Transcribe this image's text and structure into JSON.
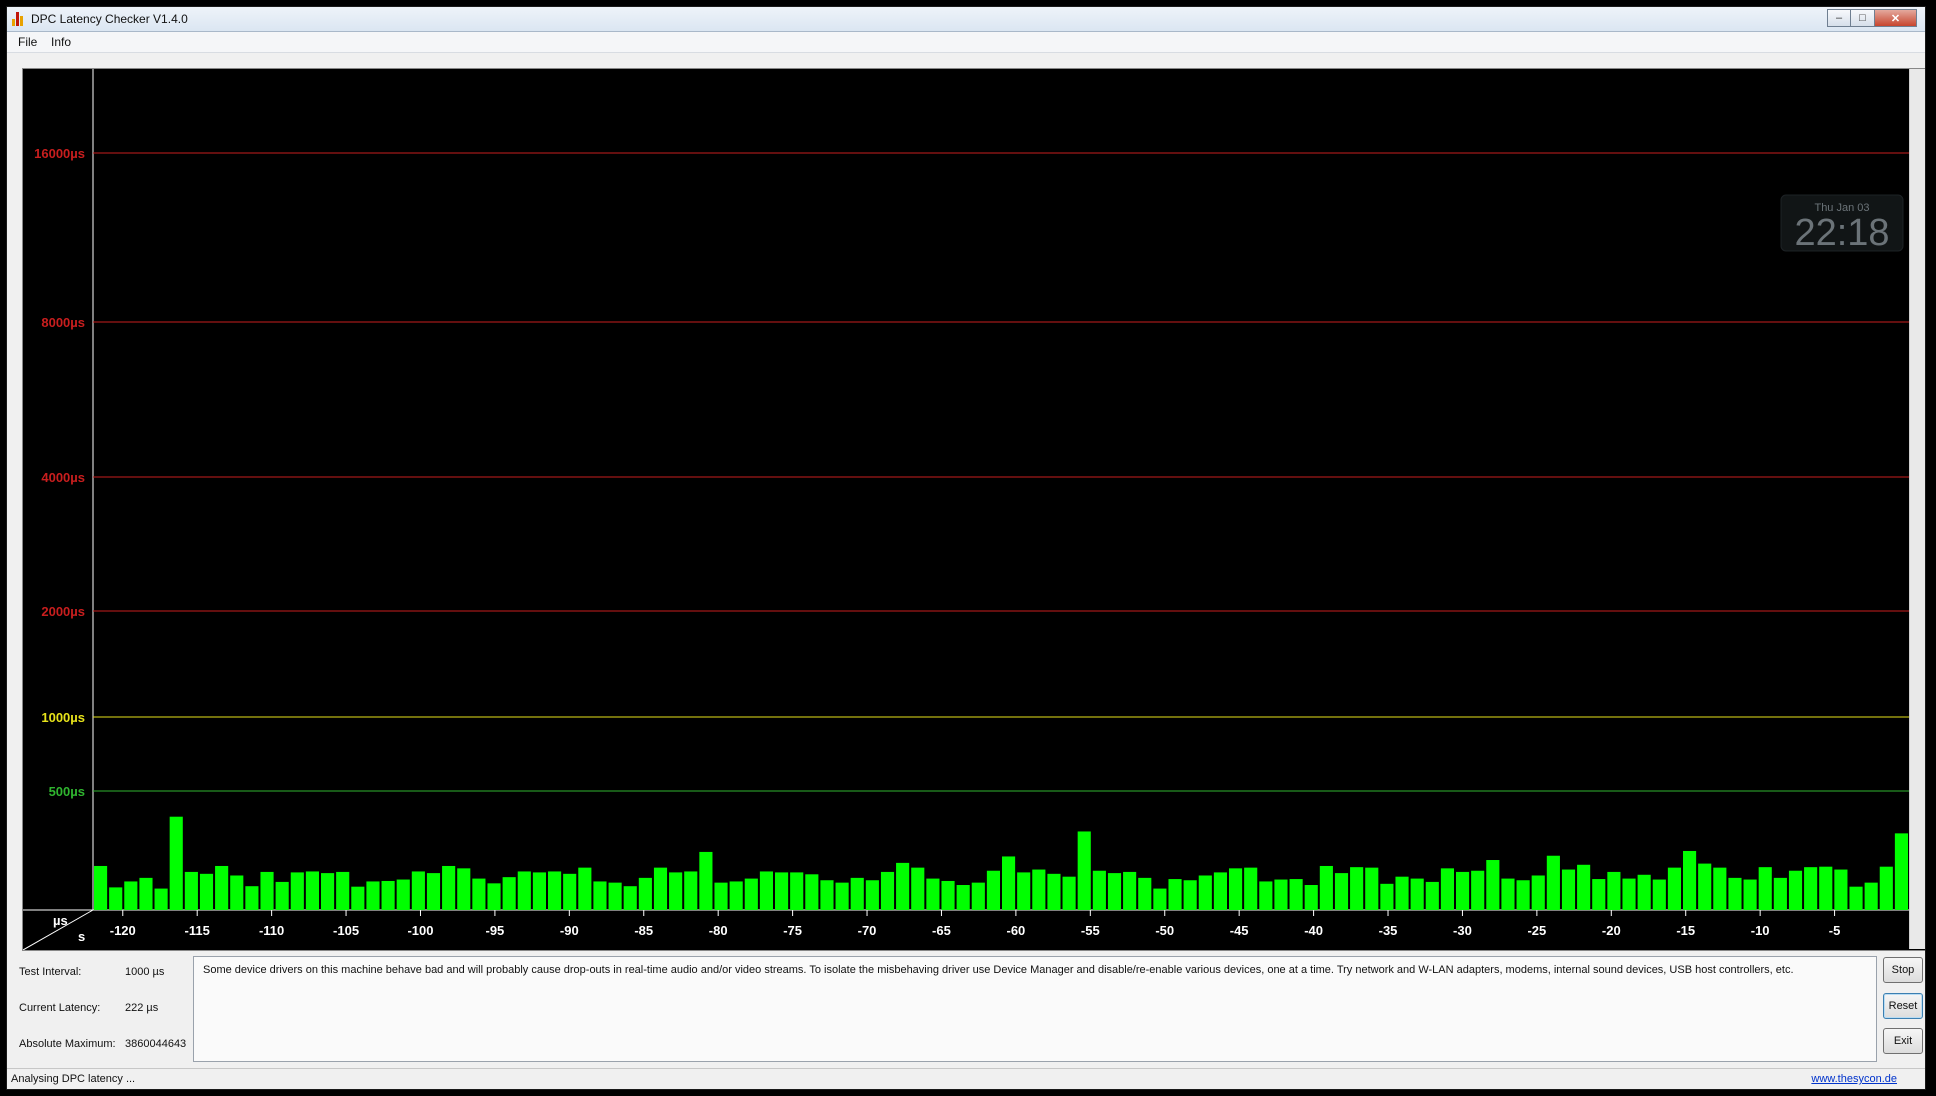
{
  "window": {
    "title": "DPC Latency Checker V1.4.0",
    "controls": {
      "minimize": "–",
      "maximize": "□",
      "close": "✕"
    }
  },
  "menu": {
    "items": [
      "File",
      "Info"
    ]
  },
  "overlay_clock": {
    "date": "Thu Jan 03",
    "time": "22:18"
  },
  "chart_data": {
    "type": "bar",
    "y_unit_label": "µs",
    "x_unit_label": "s",
    "y_levels": [
      {
        "label": "16000µs",
        "value": 16000,
        "color": "#c81e1e"
      },
      {
        "label": "8000µs",
        "value": 8000,
        "color": "#c81e1e"
      },
      {
        "label": "4000µs",
        "value": 4000,
        "color": "#c81e1e"
      },
      {
        "label": "2000µs",
        "value": 2000,
        "color": "#c81e1e"
      },
      {
        "label": "1000µs",
        "value": 1000,
        "color": "#e6e21a"
      },
      {
        "label": "500µs",
        "value": 500,
        "color": "#2fb42f"
      }
    ],
    "x_ticks": [
      "-120",
      "-115",
      "-110",
      "-105",
      "-100",
      "-95",
      "-90",
      "-85",
      "-80",
      "-75",
      "-70",
      "-65",
      "-60",
      "-55",
      "-50",
      "-45",
      "-40",
      "-35",
      "-30",
      "-25",
      "-20",
      "-15",
      "-10",
      "-5"
    ],
    "x_range": [
      -122,
      0
    ],
    "bar_color": "#00ff00",
    "values": [
      185,
      95,
      120,
      135,
      90,
      392,
      160,
      152,
      185,
      145,
      100,
      160,
      118,
      158,
      162,
      155,
      160,
      98,
      120,
      122,
      128,
      162,
      155,
      185,
      175,
      132,
      112,
      138,
      162,
      158,
      162,
      152,
      178,
      120,
      115,
      100,
      135,
      178,
      158,
      162,
      244,
      115,
      120,
      132,
      162,
      158,
      158,
      150,
      125,
      115,
      135,
      125,
      160,
      198,
      178,
      132,
      122,
      105,
      115,
      165,
      225,
      158,
      170,
      152,
      140,
      330,
      165,
      155,
      160,
      135,
      90,
      130,
      125,
      145,
      158,
      175,
      178,
      120,
      128,
      130,
      105,
      185,
      155,
      180,
      178,
      110,
      140,
      132,
      118,
      175,
      160,
      165,
      210,
      132,
      125,
      145,
      228,
      170,
      190,
      130,
      160,
      132,
      148,
      128,
      178,
      248,
      195,
      178,
      135,
      128,
      180,
      135,
      165,
      180,
      182,
      170,
      98,
      115,
      182,
      322
    ]
  },
  "info": {
    "test_interval": {
      "label": "Test Interval:",
      "value": "1000 µs"
    },
    "current_latency": {
      "label": "Current Latency:",
      "value": "222 µs"
    },
    "absolute_maximum": {
      "label": "Absolute Maximum:",
      "value": "3860044643"
    }
  },
  "message": "Some device drivers on this machine behave bad and will probably cause drop-outs in real-time audio and/or video streams. To isolate the misbehaving driver use Device Manager and disable/re-enable various devices, one at a time. Try network and W-LAN adapters, modems, internal sound devices, USB host controllers, etc.",
  "buttons": {
    "stop": "Stop",
    "reset": "Reset",
    "exit": "Exit"
  },
  "status": {
    "text": "Analysing DPC latency ...",
    "link": "www.thesycon.de"
  }
}
